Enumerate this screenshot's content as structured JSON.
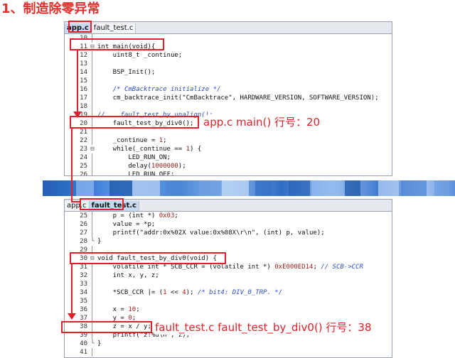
{
  "heading": "1、制造除零异常",
  "panel1": {
    "tabs": [
      "app.c",
      "fault_test.c"
    ],
    "lines": [
      {
        "n": "10",
        "g": "",
        "html": ""
      },
      {
        "n": "11",
        "g": "⊟",
        "html": "int main(void){"
      },
      {
        "n": "12",
        "g": "",
        "html": "    uint8_t _continue;"
      },
      {
        "n": "13",
        "g": "",
        "html": ""
      },
      {
        "n": "14",
        "g": "",
        "html": "    BSP_Init();"
      },
      {
        "n": "15",
        "g": "",
        "html": ""
      },
      {
        "n": "16",
        "g": "",
        "html": "    <span class=\"cmt\">/* CmBacktrace initialize */</span>"
      },
      {
        "n": "17",
        "g": "",
        "html": "    cm_backtrace_init(\"CmBacktrace\", HARDWARE_VERSION, SOFTWARE_VERSION);"
      },
      {
        "n": "18",
        "g": "",
        "html": ""
      },
      {
        "n": "19",
        "g": "",
        "html": "<span class=\"cmt\">//    fault_test_by_unalign();</span>"
      },
      {
        "n": "20",
        "g": "",
        "html": "    fault_test_by_div0();"
      },
      {
        "n": "21",
        "g": "",
        "html": ""
      },
      {
        "n": "22",
        "g": "",
        "html": "    _continue = <span class=\"num\">1</span>;"
      },
      {
        "n": "23",
        "g": "⊟",
        "html": "    while(_continue == <span class=\"num\">1</span>) {"
      },
      {
        "n": "24",
        "g": "",
        "html": "        LED_RUN_ON;"
      },
      {
        "n": "25",
        "g": "",
        "html": "        delay(<span class=\"num\">1000000</span>);"
      },
      {
        "n": "26",
        "g": "",
        "html": "        LED_RUN_OFF;"
      }
    ]
  },
  "panel2": {
    "tabs": [
      "app.c",
      "fault_test.c"
    ],
    "lines": [
      {
        "n": "25",
        "g": "",
        "html": "    p = (int *) <span class=\"num\">0x03</span>;"
      },
      {
        "n": "26",
        "g": "",
        "html": "    value = *p;"
      },
      {
        "n": "27",
        "g": "",
        "html": "    printf(\"addr:0x%02X value:0x%08X\\r\\n\", (int) p, value);"
      },
      {
        "n": "28",
        "g": "└",
        "html": "}"
      },
      {
        "n": "29",
        "g": "",
        "html": ""
      },
      {
        "n": "30",
        "g": "⊟",
        "html": "void fault_test_by_div0(void) {"
      },
      {
        "n": "31",
        "g": "",
        "html": "    volatile int * SCB_CCR = (volatile int *) <span class=\"num\">0xE000ED14</span>; <span class=\"cmt\">// SCB->CCR</span>"
      },
      {
        "n": "32",
        "g": "",
        "html": "    int x, y, z;"
      },
      {
        "n": "33",
        "g": "",
        "html": ""
      },
      {
        "n": "34",
        "g": "",
        "html": "    *SCB_CCR |= (<span class=\"num\">1</span> &lt;&lt; <span class=\"num\">4</span>); <span class=\"cmt\">/* bit4: DIV_0_TRP. */</span>"
      },
      {
        "n": "35",
        "g": "",
        "html": ""
      },
      {
        "n": "36",
        "g": "",
        "html": "    x = <span class=\"num\">10</span>;"
      },
      {
        "n": "37",
        "g": "",
        "html": "    y = <span class=\"num\">0</span>;"
      },
      {
        "n": "38",
        "g": "",
        "html": "    z = x / y;"
      },
      {
        "n": "39",
        "g": "",
        "html": "    printf(\"z:%d\\n\", z);"
      },
      {
        "n": "40",
        "g": "└",
        "html": "}"
      },
      {
        "n": "41",
        "g": "",
        "html": ""
      }
    ]
  },
  "annotations": {
    "note1": "app.c main() 行号：20",
    "note2": "fault_test.c fault_test_by_div0() 行号：38"
  },
  "colors": {
    "accent": "#e0202a",
    "heading": "#e0302b",
    "comment": "#2e4cc9",
    "number": "#9b1b1b"
  }
}
